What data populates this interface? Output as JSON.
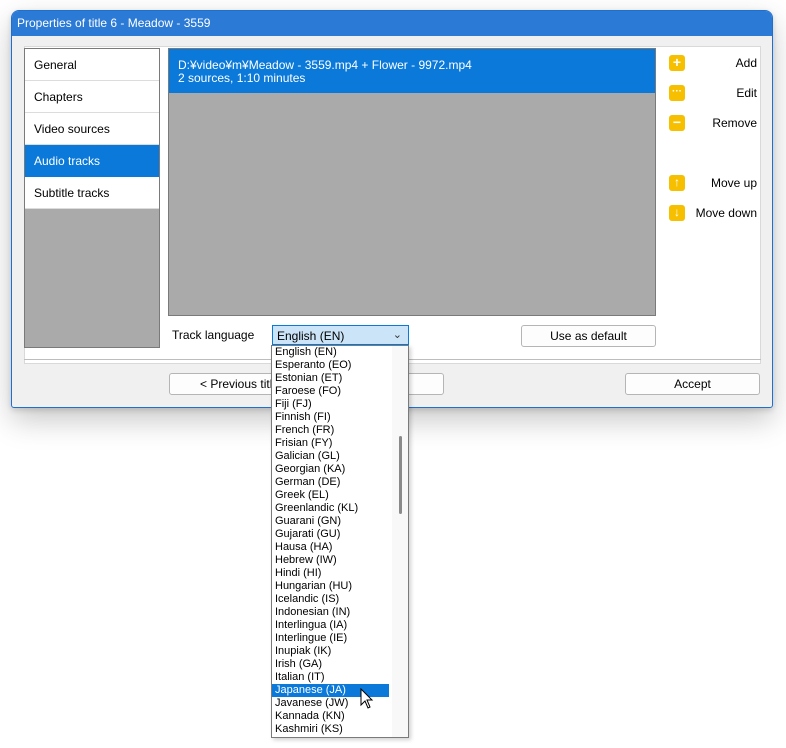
{
  "window": {
    "title": "Properties of title 6 - Meadow - 3559"
  },
  "sidebar": {
    "items": [
      {
        "label": "General"
      },
      {
        "label": "Chapters"
      },
      {
        "label": "Video sources"
      },
      {
        "label": "Audio tracks",
        "selected": true
      },
      {
        "label": "Subtitle tracks"
      }
    ]
  },
  "tracks": [
    {
      "line1": "D:¥video¥m¥Meadow - 3559.mp4 + Flower - 9972.mp4",
      "line2": "2 sources, 1:10 minutes"
    }
  ],
  "actions": {
    "add": "Add",
    "edit": "Edit",
    "remove": "Remove",
    "move_up": "Move up",
    "move_down": "Move down"
  },
  "language": {
    "label": "Track language",
    "selected": "English (EN)",
    "use_default": "Use as default",
    "options": [
      "English (EN)",
      "Esperanto (EO)",
      "Estonian (ET)",
      "Faroese (FO)",
      "Fiji (FJ)",
      "Finnish (FI)",
      "French (FR)",
      "Frisian (FY)",
      "Galician (GL)",
      "Georgian (KA)",
      "German (DE)",
      "Greek (EL)",
      "Greenlandic (KL)",
      "Guarani (GN)",
      "Gujarati (GU)",
      "Hausa (HA)",
      "Hebrew (IW)",
      "Hindi (HI)",
      "Hungarian (HU)",
      "Icelandic (IS)",
      "Indonesian (IN)",
      "Interlingua (IA)",
      "Interlingue (IE)",
      "Inupiak (IK)",
      "Irish (GA)",
      "Italian (IT)",
      "Japanese (JA)",
      "Javanese (JW)",
      "Kannada (KN)",
      "Kashmiri (KS)"
    ],
    "highlighted": "Japanese (JA)"
  },
  "footer": {
    "previous": "< Previous title",
    "accept": "Accept"
  },
  "colors": {
    "accent": "#0a79d9",
    "icon": "#f6c000",
    "titlebar": "#2b7ad6"
  }
}
